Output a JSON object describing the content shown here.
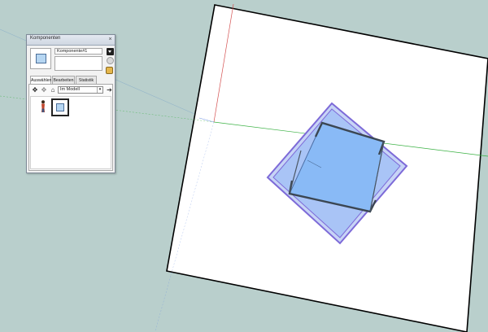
{
  "window": {
    "title": "Komponenten",
    "close_glyph": "×"
  },
  "component": {
    "name_value": "Komponente#1",
    "description_value": ""
  },
  "tabs": [
    {
      "label": "Auswählen",
      "active": true
    },
    {
      "label": "Bearbeiten",
      "active": false
    },
    {
      "label": "Statistik",
      "active": false
    }
  ],
  "navigation": {
    "collection_value": "Im Modell"
  },
  "icons": {
    "details": "details-arrow-icon",
    "thumbnail": "sphere-icon",
    "paint": "paint-bucket-icon",
    "back": "back-arrow-icon",
    "forward": "forward-arrow-icon",
    "home": "home-icon",
    "person": "person-icon"
  },
  "colors": {
    "sky": "#b9cfcc",
    "panel": "#f2f2f2",
    "component_fill": "#89baf6",
    "component_frame": "#7d6ad8",
    "axis_red": "#d44f4f",
    "axis_green": "#39b142"
  }
}
